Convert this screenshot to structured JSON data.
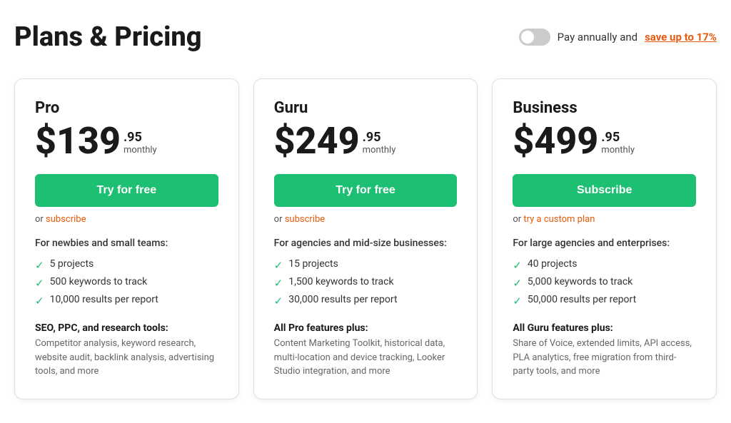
{
  "header": {
    "title": "Plans & Pricing",
    "billing": {
      "label": "Pay annually and ",
      "save_text": "save up to 17%"
    }
  },
  "plans": [
    {
      "name": "Pro",
      "price_main": "$139",
      "price_cents": ".95",
      "price_period": "monthly",
      "cta_label": "Try for free",
      "or_text": "or ",
      "or_link_text": "subscribe",
      "description": "For newbies and small teams:",
      "features": [
        "5 projects",
        "500 keywords to track",
        "10,000 results per report"
      ],
      "section_label": "SEO, PPC, and research tools:",
      "section_detail": "Competitor analysis, keyword research, website audit, backlink analysis, advertising tools, and more"
    },
    {
      "name": "Guru",
      "price_main": "$249",
      "price_cents": ".95",
      "price_period": "monthly",
      "cta_label": "Try for free",
      "or_text": "or ",
      "or_link_text": "subscribe",
      "description": "For agencies and mid-size businesses:",
      "features": [
        "15 projects",
        "1,500 keywords to track",
        "30,000 results per report"
      ],
      "section_label": "All Pro features plus:",
      "section_detail": "Content Marketing Toolkit, historical data, multi-location and device tracking, Looker Studio integration, and more"
    },
    {
      "name": "Business",
      "price_main": "$499",
      "price_cents": ".95",
      "price_period": "monthly",
      "cta_label": "Subscribe",
      "or_text": "or ",
      "or_link_text": "try a custom plan",
      "description": "For large agencies and enterprises:",
      "features": [
        "40 projects",
        "5,000 keywords to track",
        "50,000 results per report"
      ],
      "section_label": "All Guru features plus:",
      "section_detail": "Share of Voice, extended limits, API access, PLA analytics, free migration from third-party tools, and more"
    }
  ],
  "icons": {
    "check": "✓"
  }
}
